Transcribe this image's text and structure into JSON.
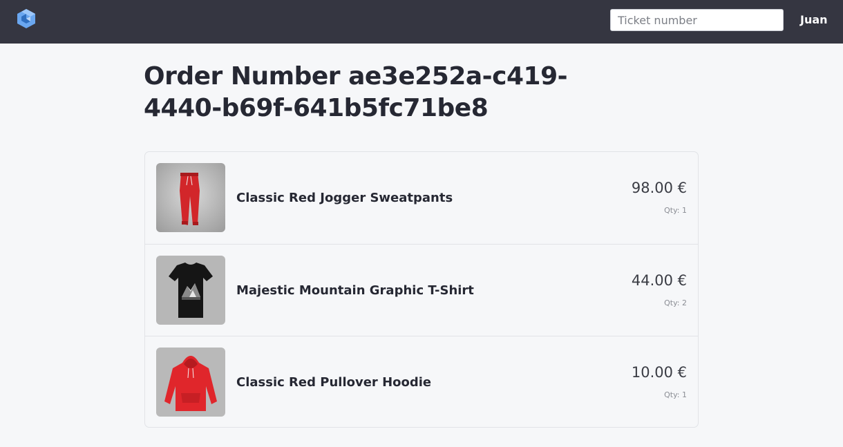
{
  "header": {
    "search_placeholder": "Ticket number",
    "user_name": "Juan"
  },
  "order": {
    "title": "Order Number ae3e252a-c419-4440-b69f-641b5fc71be8"
  },
  "items": [
    {
      "name": "Classic Red Jogger Sweatpants",
      "price": "98.00 €",
      "qty": "Qty: 1",
      "image": "red-sweatpants"
    },
    {
      "name": "Majestic Mountain Graphic T-Shirt",
      "price": "44.00 €",
      "qty": "Qty: 2",
      "image": "mountain-tshirt"
    },
    {
      "name": "Classic Red Pullover Hoodie",
      "price": "10.00 €",
      "qty": "Qty: 1",
      "image": "red-hoodie"
    }
  ],
  "colors": {
    "navbar": "#353641",
    "background": "#f6f7f9",
    "logo": "#6aa7f0"
  }
}
